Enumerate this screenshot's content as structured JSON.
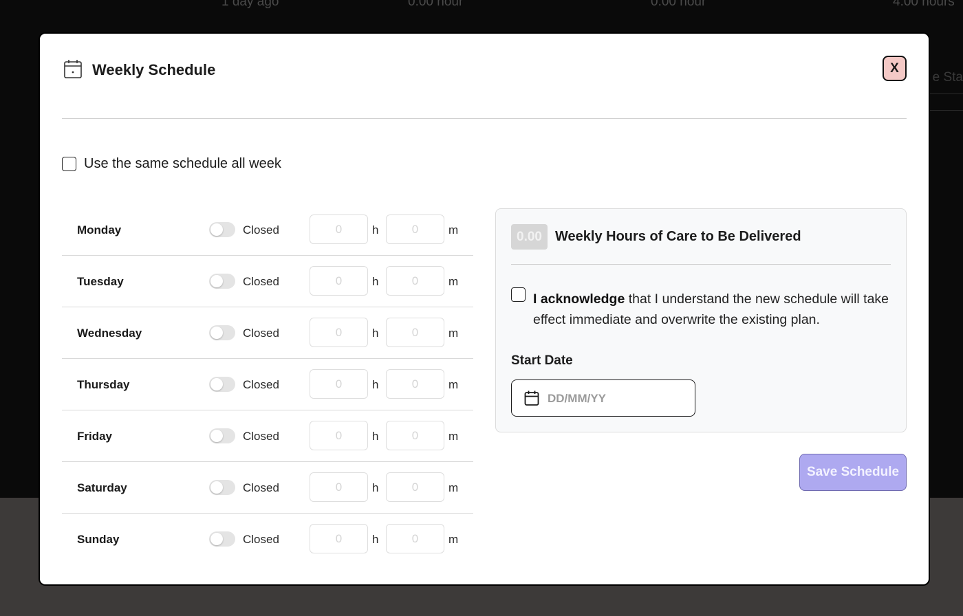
{
  "background": {
    "row_text": [
      "1 day ago",
      "0.00 hour",
      "0.00 hour",
      "4.00 hours"
    ],
    "right_text": "e Sta"
  },
  "modal": {
    "title": "Weekly Schedule",
    "close_label": "X",
    "same_schedule_label": "Use the same schedule all week",
    "days": [
      {
        "name": "Monday",
        "status": "Closed",
        "hours": "0",
        "minutes": "0"
      },
      {
        "name": "Tuesday",
        "status": "Closed",
        "hours": "0",
        "minutes": "0"
      },
      {
        "name": "Wednesday",
        "status": "Closed",
        "hours": "0",
        "minutes": "0"
      },
      {
        "name": "Thursday",
        "status": "Closed",
        "hours": "0",
        "minutes": "0"
      },
      {
        "name": "Friday",
        "status": "Closed",
        "hours": "0",
        "minutes": "0"
      },
      {
        "name": "Saturday",
        "status": "Closed",
        "hours": "0",
        "minutes": "0"
      },
      {
        "name": "Sunday",
        "status": "Closed",
        "hours": "0",
        "minutes": "0"
      }
    ],
    "units": {
      "hours": "h",
      "minutes": "m"
    },
    "summary": {
      "weekly_hours": "0.00",
      "weekly_hours_label": "Weekly Hours of Care to Be Delivered",
      "ack_bold": "I acknowledge",
      "ack_rest": " that I understand the new schedule will take effect immediate and overwrite the existing plan.",
      "start_date_label": "Start Date",
      "start_date_placeholder": "DD/MM/YY"
    },
    "save_label": "Save Schedule"
  },
  "colors": {
    "close_bg": "#f4c9c6",
    "save_bg": "#aea9f0",
    "overlay": "#0a0a0a",
    "panel_bg": "#f8f9fa"
  }
}
